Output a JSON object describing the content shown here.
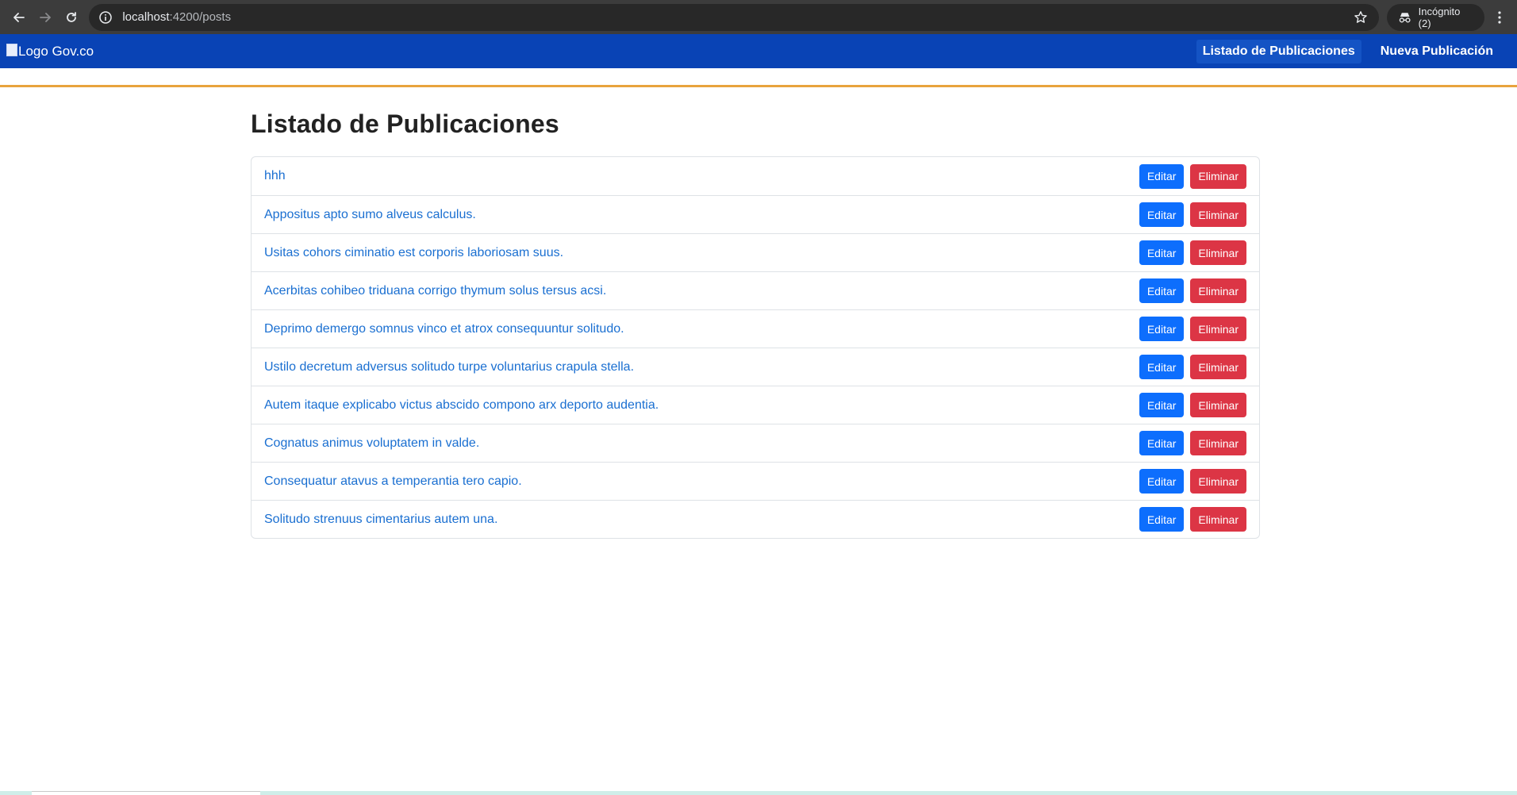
{
  "browser": {
    "url_host": "localhost",
    "url_path": ":4200/posts",
    "incognito_label": "Incógnito (2)"
  },
  "navbar": {
    "logo_alt": "Logo Gov.co",
    "links": [
      {
        "label": "Listado de Publicaciones",
        "active": true
      },
      {
        "label": "Nueva Publicación",
        "active": false
      }
    ]
  },
  "main": {
    "title": "Listado de Publicaciones",
    "edit_label": "Editar",
    "delete_label": "Eliminar",
    "posts": [
      "hhh",
      "Appositus apto sumo alveus calculus.",
      "Usitas cohors ciminatio est corporis laboriosam suus.",
      "Acerbitas cohibeo triduana corrigo thymum solus tersus acsi.",
      "Deprimo demergo somnus vinco et atrox consequuntur solitudo.",
      "Ustilo decretum adversus solitudo turpe voluntarius crapula stella.",
      "Autem itaque explicabo victus abscido compono arx deporto audentia.",
      "Cognatus animus voluptatem in valde.",
      "Consequatur atavus a temperantia tero capio.",
      "Solitudo strenuus cimentarius autem una."
    ]
  },
  "colors": {
    "navbar_bg": "#0943b5",
    "accent_line": "#e8a33d",
    "link": "#1a6fd1",
    "edit_button": "#0d6efd",
    "delete_button": "#dc3545"
  },
  "icons": {
    "back": "arrow-left-icon",
    "forward": "arrow-right-icon",
    "reload": "reload-icon",
    "site_info": "info-circle-icon",
    "bookmark": "star-icon",
    "incognito": "incognito-icon",
    "menu": "kebab-menu-icon"
  }
}
